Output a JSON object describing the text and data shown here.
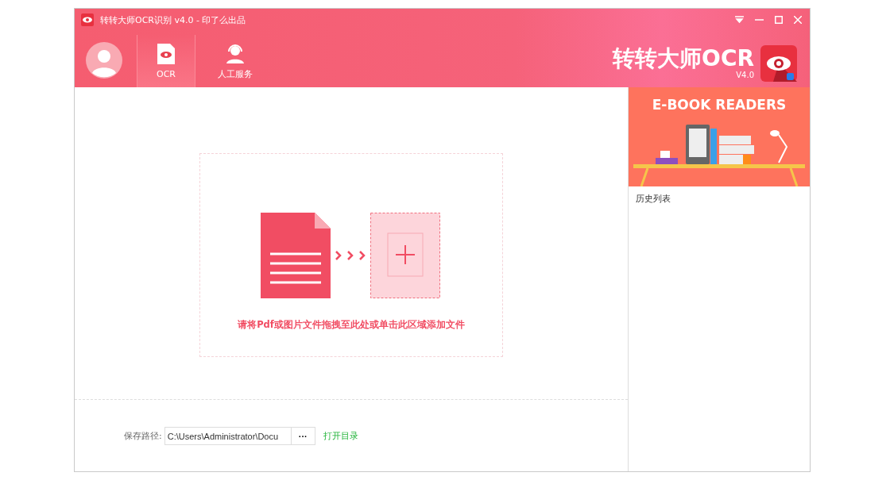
{
  "window": {
    "title": "转转大师OCR识别 v4.0 - 印了么出品"
  },
  "tabs": [
    {
      "label": "OCR",
      "kind": "ocr",
      "selected": true
    },
    {
      "label": "人工服务",
      "kind": "service",
      "selected": false
    }
  ],
  "brand": {
    "name": "转转大师OCR",
    "version": "V4.0"
  },
  "drop_zone": {
    "hint": "请将Pdf或图片文件拖拽至此处或单击此区域添加文件"
  },
  "save": {
    "label": "保存路径:",
    "path": "C:\\Users\\Administrator\\Docu",
    "browse": "···",
    "open_link": "打开目录"
  },
  "banner": {
    "title": "E-BOOK READERS"
  },
  "history": {
    "title": "历史列表"
  }
}
